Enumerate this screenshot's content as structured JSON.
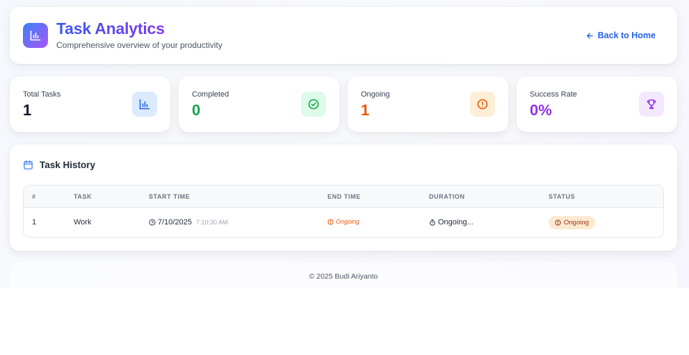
{
  "header": {
    "title": "Task Analytics",
    "subtitle": "Comprehensive overview of your productivity",
    "back_label": "Back to Home",
    "logo_icon": "bar-chart-icon",
    "back_icon": "arrow-left-icon"
  },
  "stats": [
    {
      "label": "Total Tasks",
      "value": "1",
      "icon": "bar-chart-icon",
      "value_color": "#111827",
      "icon_bg": "#dbeafe",
      "icon_color": "#2563eb"
    },
    {
      "label": "Completed",
      "value": "0",
      "icon": "check-circle-icon",
      "value_color": "#16a34a",
      "icon_bg": "#dcfce7",
      "icon_color": "#16a34a"
    },
    {
      "label": "Ongoing",
      "value": "1",
      "icon": "alert-circle-icon",
      "value_color": "#ea580c",
      "icon_bg": "#ffedd5",
      "icon_color": "#ea580c"
    },
    {
      "label": "Success Rate",
      "value": "0%",
      "icon": "trophy-icon",
      "value_color": "#9333ea",
      "icon_bg": "#f3e8ff",
      "icon_color": "#9333ea"
    }
  ],
  "history": {
    "title": "Task History",
    "icon": "calendar-icon",
    "columns": [
      "#",
      "TASK",
      "START TIME",
      "END TIME",
      "DURATION",
      "STATUS"
    ],
    "rows": [
      {
        "index": "1",
        "task": "Work",
        "start_date": "7/10/2025",
        "start_time": "7:10:30 AM",
        "end_time": "Ongoing",
        "duration": "Ongoing...",
        "status": "Ongoing"
      }
    ]
  },
  "footer": {
    "text": "© 2025 Budi Ariyanto"
  }
}
